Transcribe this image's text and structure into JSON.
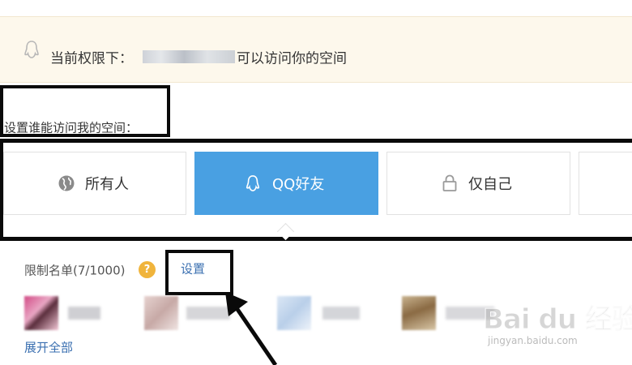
{
  "notice": {
    "prefix": "当前权限下：",
    "suffix": "可以访问你的空间"
  },
  "section_title": "设置谁能访问我的空间：",
  "options": [
    {
      "label": "所有人",
      "icon": "globe-icon",
      "selected": false
    },
    {
      "label": "QQ好友",
      "icon": "qq-penguin-icon",
      "selected": true
    },
    {
      "label": "仅自己",
      "icon": "lock-icon",
      "selected": false
    }
  ],
  "restriction": {
    "label": "限制名单(7/1000)",
    "help_icon": "?",
    "set_link": "设置",
    "expand_link": "展开全部"
  },
  "watermark": {
    "brand": "Bai du 经验",
    "url": "jingyan.baidu.com"
  },
  "colors": {
    "accent": "#49a0e2",
    "notice_bg": "#fdf8ec",
    "help": "#f0b43c",
    "link": "#3a6fb0"
  }
}
